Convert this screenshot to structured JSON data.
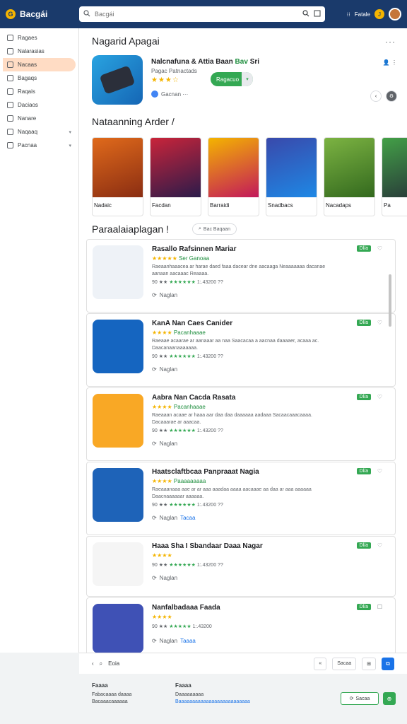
{
  "app": {
    "name": "Bacgái",
    "logo_mark": "G"
  },
  "search": {
    "placeholder": "Bacgái"
  },
  "topbar": {
    "label": "Fatale",
    "badge": "J"
  },
  "sidebar": {
    "items": [
      {
        "label": "Ragaes",
        "icon": "grid-icon",
        "chev": ""
      },
      {
        "label": "Nalarasias",
        "icon": "heart-icon",
        "chev": ""
      },
      {
        "label": "Nacaas",
        "icon": "apps-icon",
        "chev": ""
      },
      {
        "label": "Bagaqs",
        "icon": "book-icon",
        "chev": ""
      },
      {
        "label": "Raqais",
        "icon": "bubble-icon",
        "chev": ""
      },
      {
        "label": "Daciaos",
        "icon": "doc-icon",
        "chev": ""
      },
      {
        "label": "Nanare",
        "icon": "page-icon",
        "chev": ""
      },
      {
        "label": "Naqaaq",
        "icon": "chart-icon",
        "chev": "▾"
      },
      {
        "label": "Pacnaa",
        "icon": "settings-icon",
        "chev": "▾"
      }
    ]
  },
  "featured": {
    "section_title": "Nagarid Apagai",
    "title_main": "Nalcnafuna & Attia Baan",
    "title_hl": "Bav",
    "title_tail": "Sri",
    "sub": "Pagac Patnactads",
    "stars": "★★★☆",
    "install_label": "Ragacuo",
    "dev": "Gacnan ···",
    "more": "···"
  },
  "carousel": {
    "section_title": "Nataanning Arder /",
    "items": [
      {
        "label": "Nadaic",
        "color1": "#e06a1b",
        "color2": "#8a2d12"
      },
      {
        "label": "Facdan",
        "color1": "#c9243a",
        "color2": "#2b1b4a"
      },
      {
        "label": "Barraidi",
        "color1": "#f4b400",
        "color2": "#c2185b"
      },
      {
        "label": "Snadbacs",
        "color1": "#3949ab",
        "color2": "#1e88e5"
      },
      {
        "label": "Nacadaps",
        "color1": "#7cb342",
        "color2": "#33691e"
      },
      {
        "label": "Pa",
        "color1": "#43a047",
        "color2": "#263238"
      }
    ]
  },
  "list_section": {
    "title": "Paraalaiaplagan !",
    "chip": "Bac Baqaan"
  },
  "list": [
    {
      "title": "Rasallo Rafsinnen Mariar",
      "stars": "★★★★★",
      "line1": "Ser Ganoaa",
      "desc": "Raeaanhaaacea ar harae daed faaa dacear dne aacaaga Neaaaaaaa dacanae aanaan aacaaac Reaaaa.",
      "rating_prefix": "90 ★★ ",
      "rating_stars": "★★★★★★",
      "rating_val": "1:.43200 ",
      "rating_tail": "??",
      "foot": "Naglan",
      "link": "",
      "badge": "Dl/a",
      "icon_bg": "#eef2f7",
      "icon_fg": "#3a3f4a"
    },
    {
      "title": "KanA Nan Caes Canider",
      "stars": "★★★★",
      "line1": "Pacanhaaae",
      "desc": "Raeaae acaarae ar aanaaar aa naa Saacacaa a aacnaa daaaaer, acaaa ac. Daacanaanaaaaaaa.",
      "rating_prefix": "90 ★★ ",
      "rating_stars": "★★★★★★",
      "rating_val": "1:.43200 ",
      "rating_tail": "??",
      "foot": "Naglan",
      "link": "",
      "badge": "Dl/a",
      "icon_bg": "#1565c0",
      "icon_fg": "#1b1b1b"
    },
    {
      "title": "Aabra Nan Cacda Rasata",
      "stars": "★★★★",
      "line1": "Pacanhaaae",
      "desc": "Raeaaan acaae ar haaa aar daa daa daaaaaa aadaaa Sacaacaaacaaaa. Dacaaarae ar aaacaa.",
      "rating_prefix": "90 ★★ ",
      "rating_stars": "★★★★★★",
      "rating_val": "1:.43200 ",
      "rating_tail": "??",
      "foot": "Naglan",
      "link": "",
      "badge": "Dl/a",
      "icon_bg": "#f9a825",
      "icon_fg": "#263238"
    },
    {
      "title": "Haatsclaftbcaa Panpraaat Nagia",
      "stars": "★★★★",
      "line1": "Paaaaaaaaa",
      "desc": "Raeaaanaaa aae ar ar aaa aaadaa aaaa aacaaae aa daa ar aaa aaaaaa Daacnaaaaaar aaaaaa.",
      "rating_prefix": "90 ★★ ",
      "rating_stars": "★★★★★★",
      "rating_val": "1:.43200 ",
      "rating_tail": "??",
      "foot": "Naglan",
      "link": "Tacaa",
      "badge": "Dl/a",
      "icon_bg": "#1e63b8",
      "icon_fg": "#c97a3a"
    },
    {
      "title": "Haaa Sha I Sbandaar Daaa Nagar",
      "stars": "★★★★",
      "line1": "",
      "desc": "",
      "rating_prefix": "90 ★★ ",
      "rating_stars": "★★★★★★",
      "rating_val": "1:.43200 ",
      "rating_tail": "??",
      "foot": "Naglan",
      "link": "",
      "badge": "Dl/a",
      "icon_bg": "#f5f5f5",
      "icon_fg": "#2b2f3a"
    },
    {
      "title": "Nanfalbadaaa Faada",
      "stars": "★★★★",
      "line1": "",
      "desc": "",
      "rating_prefix": "90 ★★ ",
      "rating_stars": "★★★★★",
      "rating_val": "1:.43200 ",
      "rating_tail": "",
      "foot": "Naglan",
      "link": "Taaaa",
      "badge": "Dl/a",
      "icon_bg": "#3f51b5",
      "icon_fg": "#e3a35c"
    }
  ],
  "toolbar": {
    "back": "‹",
    "search_label": "Eoia",
    "btn1": "«",
    "btn2": "Sacaa",
    "btn3": "⊞",
    "btn4": "⧉"
  },
  "footer": {
    "col1_title": "Faaaa",
    "col1_links": [
      "Fabacaaaa daaaa",
      "Bacaaacaaaaaa"
    ],
    "col2_title": "Faaaa",
    "col2_links": [
      "Daaaaaaaaa",
      "Baaaaaaaaaaaaaaaaaaaaaaaaaa"
    ],
    "btn_label": "Sacaa",
    "green": "⊕"
  },
  "colors": {
    "accent": "#1a3a6b",
    "active": "#ffdcc4",
    "green": "#34a853",
    "star": "#f4b400"
  }
}
